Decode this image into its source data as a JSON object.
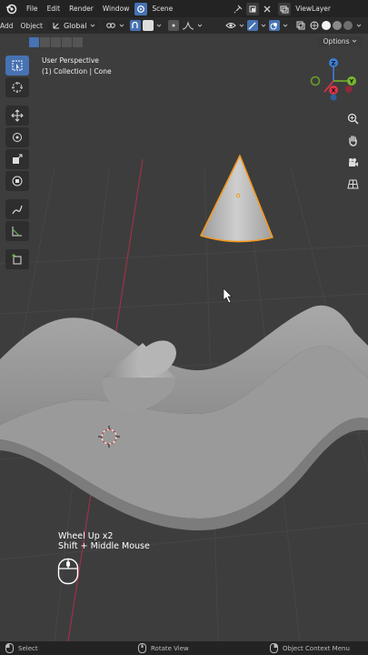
{
  "topbar": {
    "menus": [
      "File",
      "Edit",
      "Render",
      "Window"
    ],
    "scene": "Scene",
    "view_layer": "ViewLayer"
  },
  "header": {
    "add": "Add",
    "object": "Object",
    "orientation": "Global"
  },
  "options": "Options",
  "viewport": {
    "view_name": "User Perspective",
    "collection": "(1) Collection | Cone"
  },
  "gizmo": {
    "x": "X",
    "y": "Y",
    "z": "Z"
  },
  "keycast": {
    "line1": "Wheel Up x2",
    "line2": "Shift + Middle Mouse"
  },
  "status": {
    "select": "Select",
    "rotate": "Rotate View",
    "context": "Object Context Menu"
  },
  "colors": {
    "accent": "#4772b3",
    "selection_outline": "#f39a1f",
    "axis_x": "#e0334a",
    "axis_y": "#78b82a",
    "axis_z": "#3b7fd9"
  }
}
